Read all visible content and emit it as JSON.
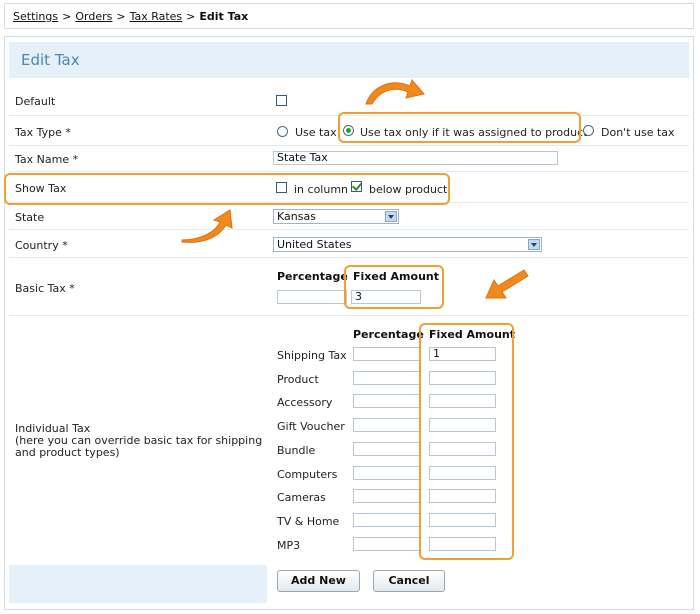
{
  "breadcrumb": {
    "items": [
      "Settings",
      "Orders",
      "Tax Rates"
    ],
    "current": "Edit Tax",
    "separator": ">"
  },
  "panel": {
    "title": "Edit Tax"
  },
  "form": {
    "default_label": "Default",
    "tax_type": {
      "label": "Tax Type *",
      "options": [
        "Use tax",
        "Use tax only if it was assigned to product",
        "Don't use tax"
      ],
      "selected": "Use tax only if it was assigned to product"
    },
    "tax_name": {
      "label": "Tax Name *",
      "value": "State Tax"
    },
    "show_tax": {
      "label": "Show Tax",
      "in_column": "in column",
      "below_product": "below product"
    },
    "state": {
      "label": "State",
      "value": "Kansas"
    },
    "country": {
      "label": "Country *",
      "value": "United States"
    },
    "basic_tax": {
      "label": "Basic Tax *",
      "percentage_header": "Percentage",
      "fixed_header": "Fixed Amount",
      "percentage_value": "",
      "fixed_value": "3"
    },
    "individual_tax": {
      "label_line1": "Individual Tax",
      "label_line2": "(here you can override basic tax for shipping",
      "label_line3": "and product types)",
      "percentage_header": "Percentage",
      "fixed_header": "Fixed Amount",
      "rows": [
        {
          "name": "Shipping Tax",
          "percentage": "",
          "fixed": "1"
        },
        {
          "name": "Product",
          "percentage": "",
          "fixed": ""
        },
        {
          "name": "Accessory",
          "percentage": "",
          "fixed": ""
        },
        {
          "name": "Gift Voucher",
          "percentage": "",
          "fixed": ""
        },
        {
          "name": "Bundle",
          "percentage": "",
          "fixed": ""
        },
        {
          "name": "Computers",
          "percentage": "",
          "fixed": ""
        },
        {
          "name": "Cameras",
          "percentage": "",
          "fixed": ""
        },
        {
          "name": "TV & Home",
          "percentage": "",
          "fixed": ""
        },
        {
          "name": "MP3",
          "percentage": "",
          "fixed": ""
        }
      ]
    }
  },
  "buttons": {
    "add_new": "Add New",
    "cancel": "Cancel"
  },
  "colors": {
    "accent": "#f0a030",
    "title_blue": "#4a86b8",
    "header_bg": "#e6f0f9"
  }
}
